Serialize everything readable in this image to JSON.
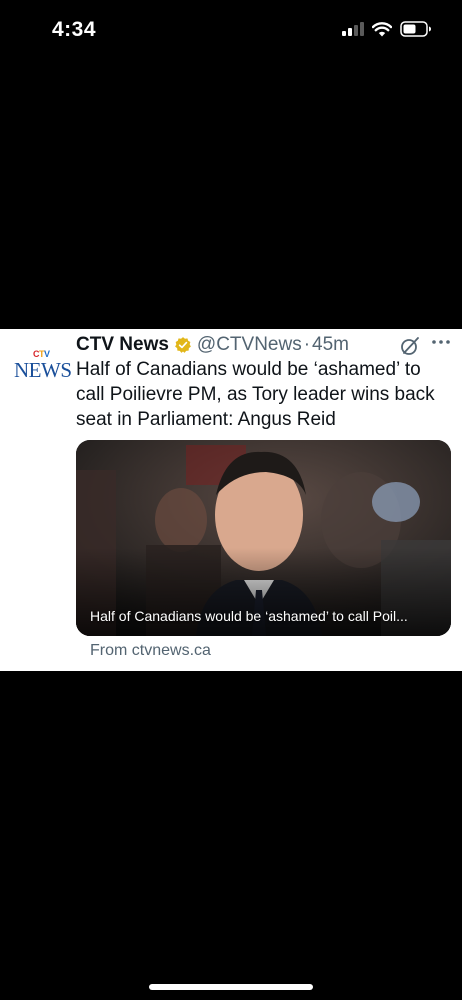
{
  "status_bar": {
    "time": "4:34",
    "signal_icon": "cellular-signal-icon",
    "wifi_icon": "wifi-icon",
    "battery_icon": "battery-icon"
  },
  "tweet": {
    "avatar": {
      "logo_text_top": "CTV",
      "logo_text_bottom": "NEWS"
    },
    "author_name": "CTV News",
    "verified_icon": "verified-badge-icon",
    "handle": "@CTVNews",
    "separator": "·",
    "timestamp": "45m",
    "grok_icon": "grok-icon",
    "more_icon": "more-options-icon",
    "text": "Half of Canadians would be ‘ashamed’ to call Poilievre PM, as Tory leader wins back seat in Parliament: Angus Reid",
    "media": {
      "caption": "Half of Canadians would be ‘ashamed’ to call Poil..."
    },
    "source": "From ctvnews.ca"
  },
  "colors": {
    "background": "#000000",
    "card": "#ffffff",
    "text_primary": "#0f1419",
    "text_secondary": "#536471",
    "verified_gold": "#e2b719",
    "ctv_red": "#d7262b",
    "ctv_yellow": "#f0a218",
    "ctv_blue": "#1f6ec9",
    "news_blue": "#1a4f9a"
  }
}
